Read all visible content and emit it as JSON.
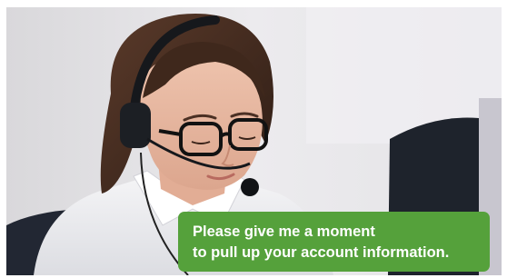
{
  "photo": {
    "subject": "customer-support-agent-with-headset"
  },
  "caption": {
    "line1": "Please give me a moment",
    "line2": "to pull up your account information."
  },
  "colors": {
    "caption_background": "#55a13b",
    "caption_text": "#ffffff",
    "backdrop": "#e6e5e8"
  }
}
